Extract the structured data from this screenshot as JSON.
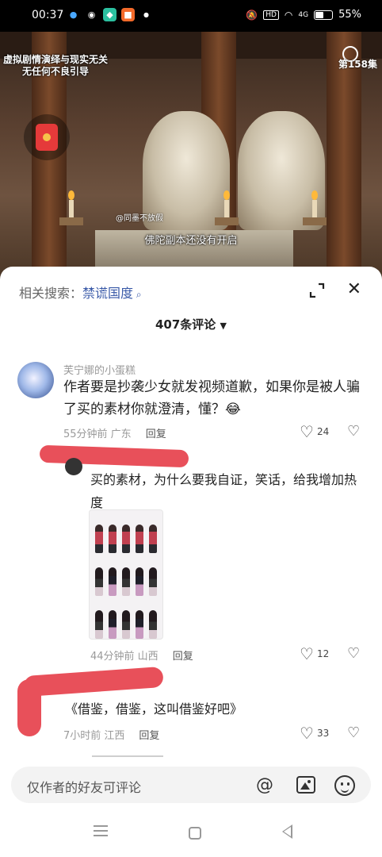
{
  "status_bar": {
    "time": "00:37",
    "battery": "55%",
    "battery_level": 0.55,
    "network": "4G",
    "hd": "HD"
  },
  "video": {
    "overlay_line1": "虚拟剧情演绎与现实无关",
    "overlay_line2": "无任何不良引导",
    "episode": "第158集",
    "watermark": "@同墨不放假",
    "subtitle": "佛陀副本还没有开启"
  },
  "sheet": {
    "related_label": "相关搜索：",
    "related_keyword": "禁谎国度",
    "comment_count": "407条评论",
    "comments": [
      {
        "author": "芙宁娜的小蛋糕",
        "text": "作者要是抄袭少女就发视频道歉，如果你是被人骗了买的素材你就澄清，懂？😂",
        "time_location": "55分钟前 广东",
        "reply_label": "回复",
        "likes": "24"
      },
      {
        "text": "买的素材，为什么要我自证，笑话，给我增加热度",
        "time_location": "44分钟前 山西",
        "reply_label": "回复",
        "likes": "12"
      },
      {
        "text": "《借鉴，借鉴，这叫借鉴好吧》",
        "time_location": "7小时前 江西",
        "reply_label": "回复",
        "likes": "33"
      }
    ]
  },
  "input": {
    "placeholder": "仅作者的好友可评论"
  },
  "colors": {
    "accent_link": "#3a5aa8",
    "redaction": "#e8505a"
  }
}
